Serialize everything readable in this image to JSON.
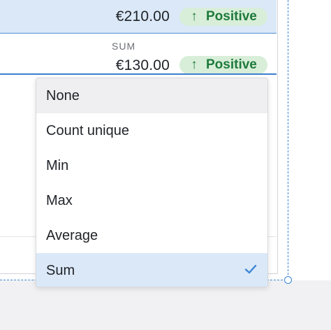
{
  "table": {
    "selected_row": {
      "value": "€210.00",
      "badge": {
        "arrow": "↑",
        "label": "Positive"
      }
    },
    "sum_row": {
      "caption": "SUM",
      "value": "€130.00",
      "badge": {
        "arrow": "↑",
        "label": "Positive"
      }
    }
  },
  "dropdown": {
    "options": [
      {
        "label": "None",
        "state": "hover"
      },
      {
        "label": "Count unique",
        "state": "default"
      },
      {
        "label": "Min",
        "state": "default"
      },
      {
        "label": "Max",
        "state": "default"
      },
      {
        "label": "Average",
        "state": "default"
      },
      {
        "label": "Sum",
        "state": "selected"
      }
    ],
    "selected_icon": "checkmark-icon"
  },
  "colors": {
    "selection_bg": "#dbe8f7",
    "accent": "#3b86d6",
    "badge_bg": "#d8eed9",
    "badge_text": "#1f7a3c"
  }
}
